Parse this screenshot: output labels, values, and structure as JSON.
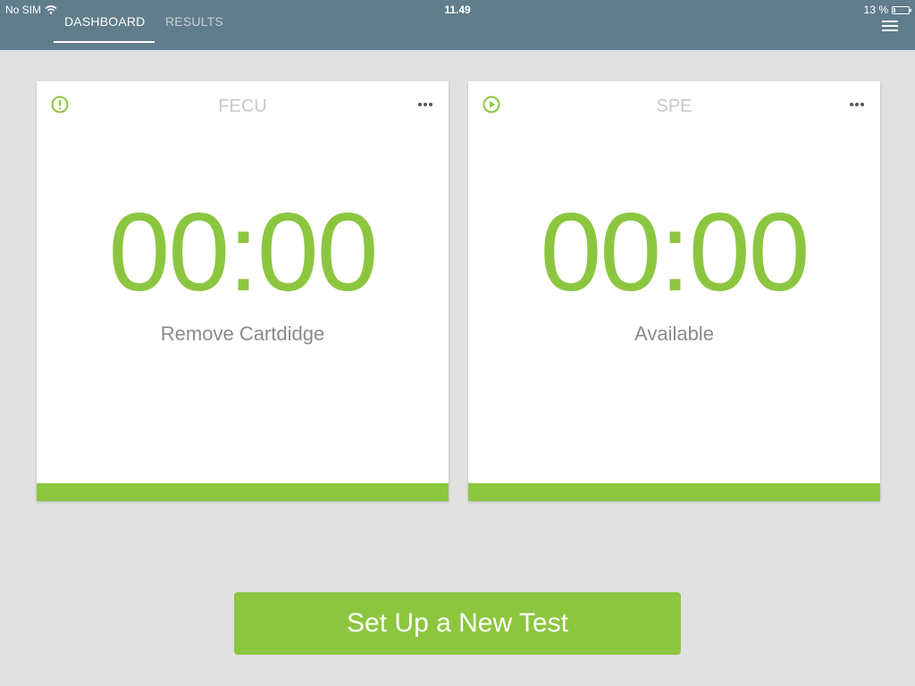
{
  "status_bar": {
    "carrier": "No SIM",
    "time": "11.49",
    "battery_text": "13 %",
    "battery_level": 0.13
  },
  "nav": {
    "tabs": [
      {
        "label": "DASHBOARD",
        "active": true
      },
      {
        "label": "RESULTS",
        "active": false
      }
    ],
    "menu_icon": "hamburger-menu-icon"
  },
  "cards": [
    {
      "name": "FECU",
      "status_icon": "alert-icon",
      "timer": "00:00",
      "status": "Remove Cartdidge"
    },
    {
      "name": "SPE",
      "status_icon": "play-icon",
      "timer": "00:00",
      "status": "Available"
    }
  ],
  "actions": {
    "setup_label": "Set Up a New Test"
  },
  "colors": {
    "accent": "#8cc63f",
    "header": "#607d8b",
    "background": "#e1e1e1"
  }
}
